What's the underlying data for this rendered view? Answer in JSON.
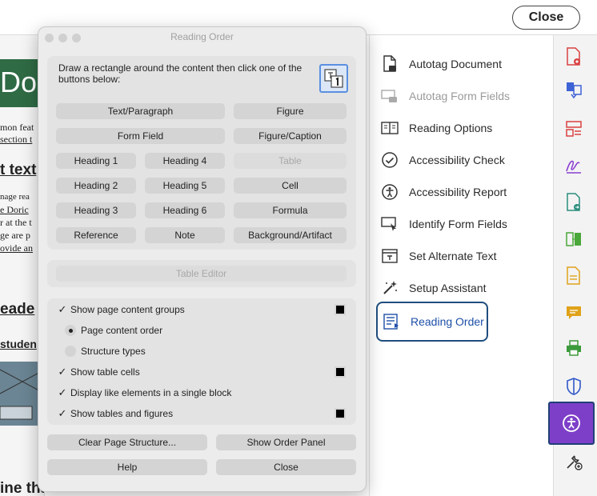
{
  "topbar": {
    "close_label": "Close"
  },
  "document": {
    "banner_text": "Doc",
    "fragments": [
      "mon feat",
      "section t",
      "t text",
      "nage rea",
      "e Doric",
      "r at the t",
      "ge are p",
      "ovide an",
      "eade",
      "studen",
      "ine that needs a specific reading"
    ]
  },
  "dialog": {
    "title": "Reading Order",
    "instruction": "Draw a rectangle around the content then click one of the buttons below:",
    "tag_buttons": {
      "text_paragraph": "Text/Paragraph",
      "figure": "Figure",
      "form_field": "Form Field",
      "figure_caption": "Figure/Caption",
      "heading1": "Heading 1",
      "heading4": "Heading 4",
      "table": "Table",
      "heading2": "Heading 2",
      "heading5": "Heading 5",
      "cell": "Cell",
      "heading3": "Heading 3",
      "heading6": "Heading 6",
      "formula": "Formula",
      "reference": "Reference",
      "note": "Note",
      "background_artifact": "Background/Artifact"
    },
    "table_editor": "Table Editor",
    "options": {
      "show_groups": "Show page content groups",
      "page_content_order": "Page content order",
      "structure_types": "Structure types",
      "show_table_cells": "Show table cells",
      "display_like": "Display like elements in a single block",
      "show_tables_figures": "Show tables and figures"
    },
    "footer": {
      "clear": "Clear Page Structure...",
      "show_order": "Show Order Panel",
      "help": "Help",
      "close": "Close"
    }
  },
  "tools": {
    "items": [
      {
        "label": "Autotag Document",
        "icon": "document-tag-icon",
        "enabled": true
      },
      {
        "label": "Autotag Form Fields",
        "icon": "form-tag-icon",
        "enabled": false
      },
      {
        "label": "Reading Options",
        "icon": "book-icon",
        "enabled": true
      },
      {
        "label": "Accessibility Check",
        "icon": "check-circle-icon",
        "enabled": true
      },
      {
        "label": "Accessibility Report",
        "icon": "accessibility-person-icon",
        "enabled": true
      },
      {
        "label": "Identify Form Fields",
        "icon": "form-cursor-icon",
        "enabled": true
      },
      {
        "label": "Set Alternate Text",
        "icon": "alt-text-icon",
        "enabled": true
      },
      {
        "label": "Setup Assistant",
        "icon": "magic-wand-icon",
        "enabled": true
      },
      {
        "label": "Reading Order",
        "icon": "reading-order-icon",
        "enabled": true,
        "selected": true
      }
    ]
  },
  "colors": {
    "rail_selected": "#7e3fc8",
    "selection_border": "#1f3f78",
    "link_blue": "#1d4fa8"
  }
}
